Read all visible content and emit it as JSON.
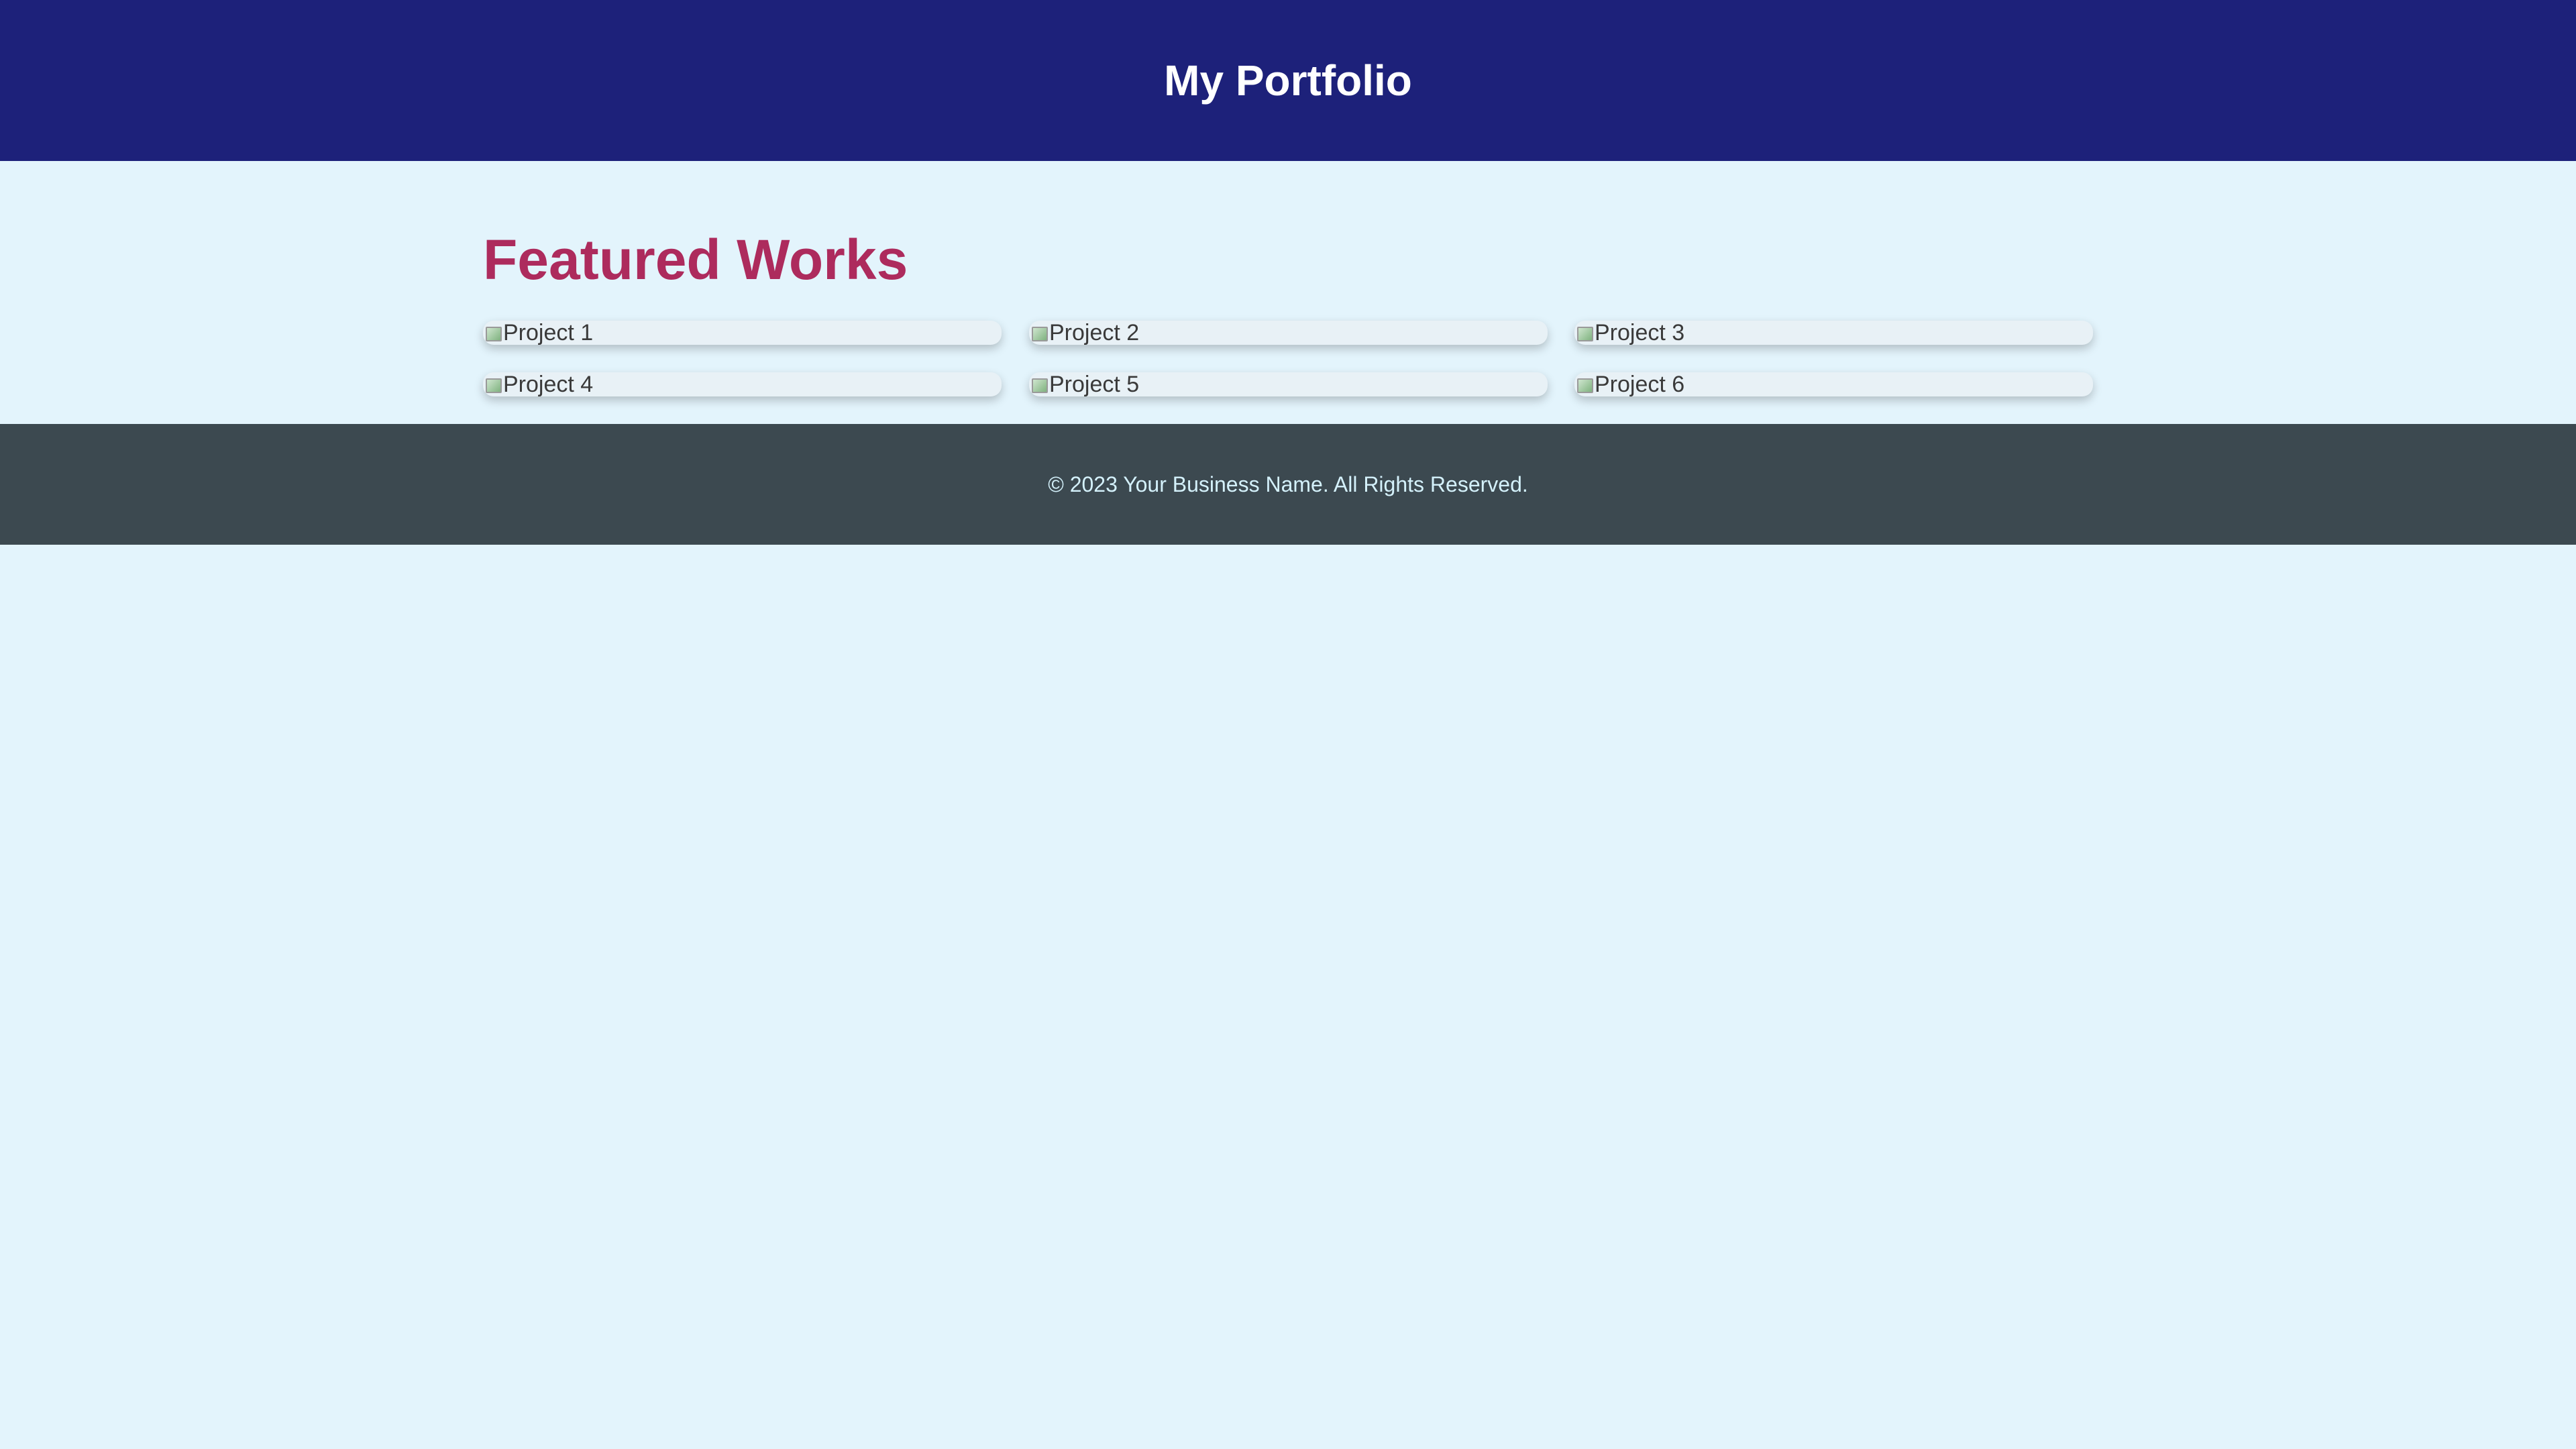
{
  "header": {
    "title": "My Portfolio"
  },
  "main": {
    "heading": "Featured Works",
    "projects": [
      {
        "alt": "Project 1",
        "icon": "broken-image-icon"
      },
      {
        "alt": "Project 2",
        "icon": "broken-image-icon"
      },
      {
        "alt": "Project 3",
        "icon": "broken-image-icon"
      },
      {
        "alt": "Project 4",
        "icon": "broken-image-icon"
      },
      {
        "alt": "Project 5",
        "icon": "broken-image-icon"
      },
      {
        "alt": "Project 6",
        "icon": "broken-image-icon"
      }
    ]
  },
  "footer": {
    "text": "© 2023 Your Business Name. All Rights Reserved."
  },
  "colors": {
    "header_bg": "#1d217a",
    "page_bg": "#e3f4fc",
    "heading": "#ad2b5d",
    "footer_bg": "#3c4950",
    "footer_text": "#d4f1fb"
  }
}
